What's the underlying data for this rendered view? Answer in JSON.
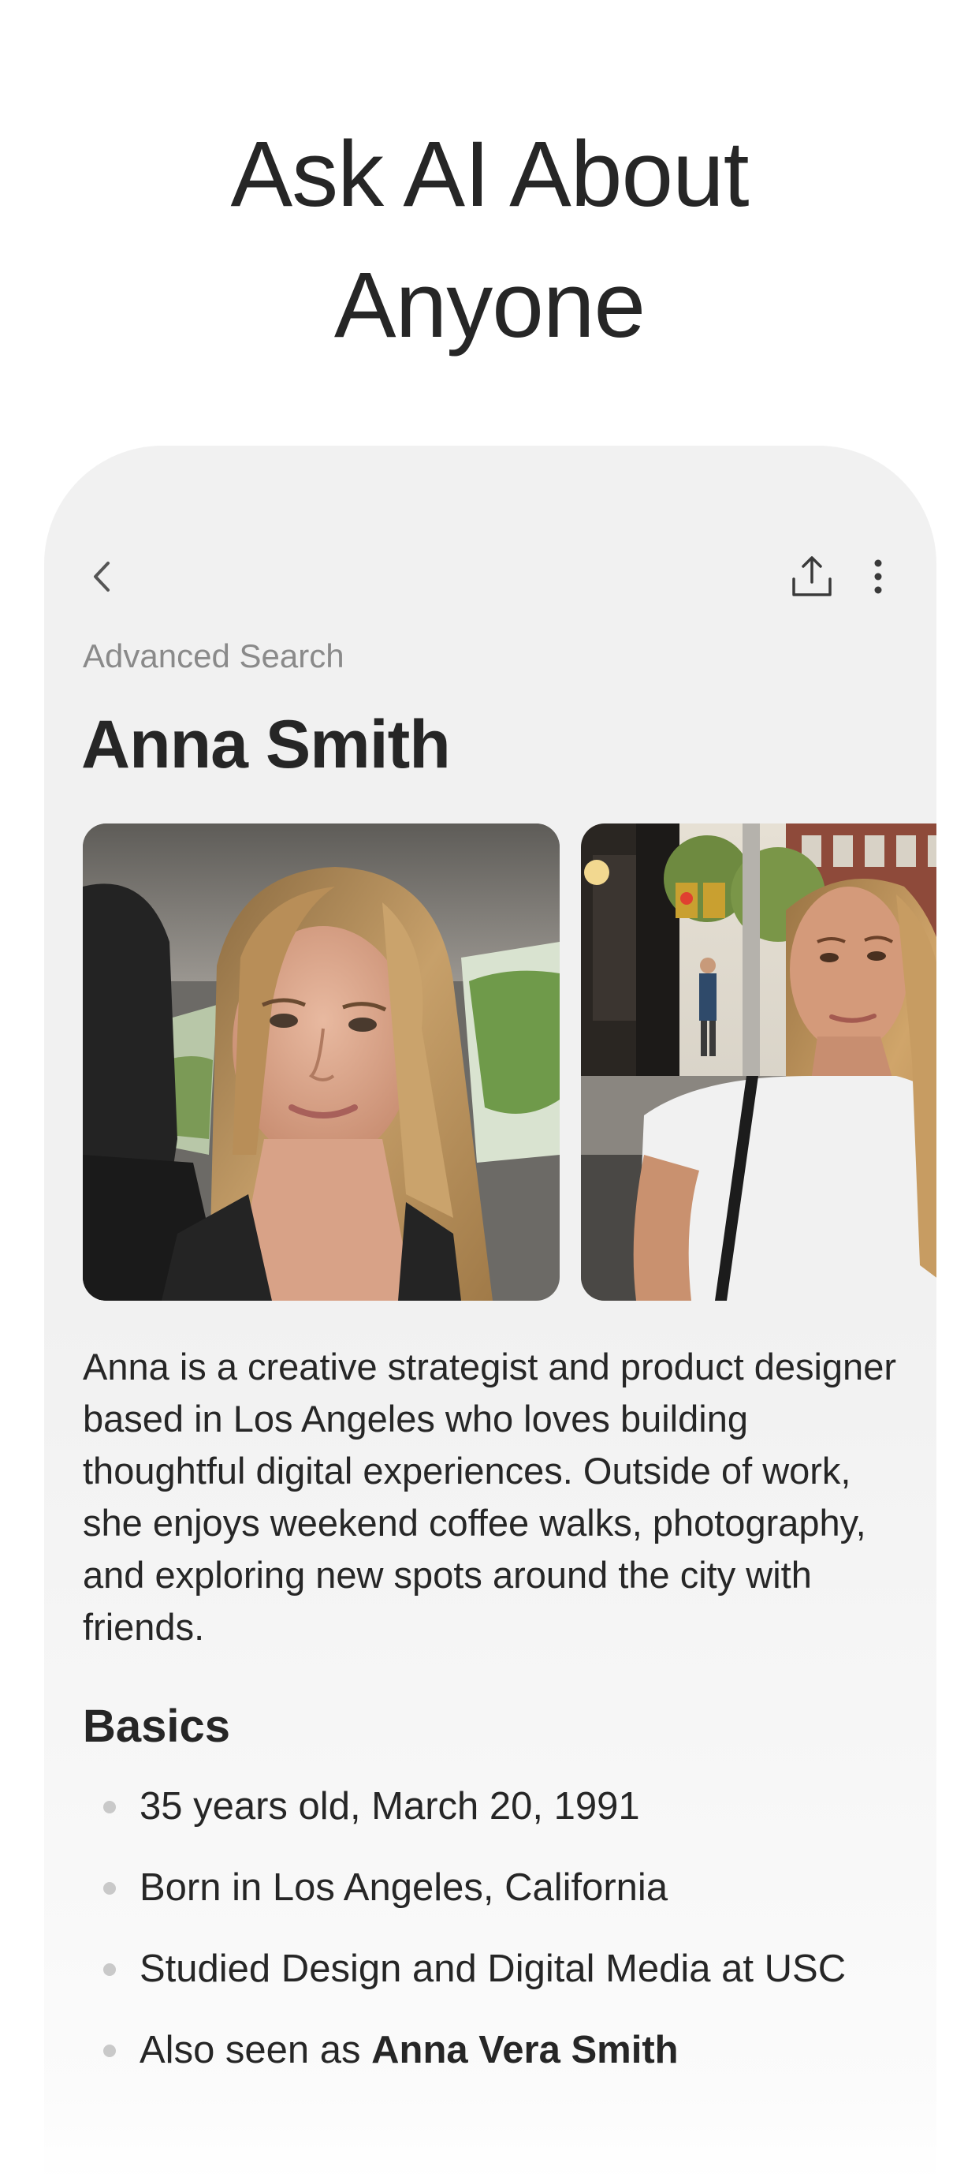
{
  "headline": {
    "line1": "Ask AI About",
    "line2": "Anyone"
  },
  "nav": {
    "back_icon": "chevron-left-icon",
    "share_icon": "share-upload-icon",
    "more_icon": "more-vertical-icon"
  },
  "profile": {
    "subtitle": "Advanced Search",
    "name": "Anna Smith",
    "photos": [
      {
        "description_icon": "photo-car-selfie"
      },
      {
        "description_icon": "photo-street"
      }
    ],
    "bio": "Anna is a creative strategist and product designer based in Los Angeles who loves building thoughtful digital experiences. Outside of work, she enjoys weekend coffee walks, photography, and exploring new spots around the city with friends."
  },
  "basics": {
    "title": "Basics",
    "items": [
      {
        "text": "35 years old, March 20, 1991"
      },
      {
        "text": "Born in Los Angeles, California"
      },
      {
        "text": "Studied Design and Digital Media at USC"
      },
      {
        "prefix": "Also seen as ",
        "bold": "Anna Vera Smith"
      }
    ]
  },
  "colors": {
    "text": "#262626",
    "muted": "#8a8a8a",
    "card_bg": "#f1f1f1",
    "bullet": "#c9c9c9"
  }
}
